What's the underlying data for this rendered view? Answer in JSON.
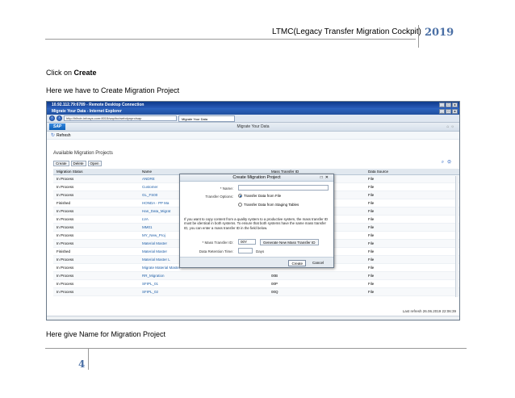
{
  "header": {
    "title": "LTMC(Legacy Transfer Migration Cockpit)",
    "year": "2019"
  },
  "body": {
    "line1_prefix": "Click on ",
    "line1_bold": "Create",
    "line2": "Here we have to Create Migration Project",
    "line3": "Here give Name for Migration Project"
  },
  "footer": {
    "page_number": "4"
  },
  "screenshot": {
    "rdp_title": "10.92.112.79:6789 - Remote Desktop Connection",
    "ie_title": "Migrate Your Data - Internet Explorer",
    "address": "http://hlhctr-infosys.com:8015/sap/bc/webdynpro/sap",
    "tab_label": "Migrate Your Data",
    "sap_logo": "SAP",
    "app_title": "Migrate Your Data",
    "refresh_label": "Refresh",
    "section_title": "Available Migration Projects",
    "buttons": {
      "create": "Create",
      "delete": "Delete",
      "open": "Open"
    },
    "columns": [
      "Migration Status",
      "Name",
      "Mass Transfer ID",
      "Data Source"
    ],
    "rows": [
      {
        "status": "In Process",
        "name": "ANDRE",
        "id": "",
        "source": "File"
      },
      {
        "status": "In Process",
        "name": "Customer",
        "id": "",
        "source": "File"
      },
      {
        "status": "In Process",
        "name": "GL_FS00",
        "id": "",
        "source": "File"
      },
      {
        "status": "Finished",
        "name": "HONDA - PP Ma",
        "id": "",
        "source": "File"
      },
      {
        "status": "In Process",
        "name": "Han_Data_Migrat",
        "id": "",
        "source": "File"
      },
      {
        "status": "In Process",
        "name": "LVA",
        "id": "",
        "source": "File"
      },
      {
        "status": "In Process",
        "name": "MM01",
        "id": "",
        "source": "File"
      },
      {
        "status": "In Process",
        "name": "MY_New_Proj",
        "id": "",
        "source": "File"
      },
      {
        "status": "In Process",
        "name": "Material Master",
        "id": "",
        "source": "File"
      },
      {
        "status": "Finished",
        "name": "Material Master",
        "id": "",
        "source": "File"
      },
      {
        "status": "In Process",
        "name": "Material Master L",
        "id": "",
        "source": "File"
      },
      {
        "status": "In Process",
        "name": "Migrate Material Master",
        "id": "",
        "source": "File"
      },
      {
        "status": "In Process",
        "name": "RR_Migration",
        "id": "00B",
        "source": "File"
      },
      {
        "status": "In Process",
        "name": "SFIPL_01",
        "id": "00P",
        "source": "File"
      },
      {
        "status": "In Process",
        "name": "SFIPL_02",
        "id": "00Q",
        "source": "File"
      }
    ],
    "last_refresh": "Last refresh 26.06.2019 22:06:39",
    "dialog": {
      "title": "Create Migration Project",
      "name_label": "* Name:",
      "name_value": "",
      "transfer_label": "Transfer Options:",
      "option1": "Transfer Data from File",
      "option2": "Transfer Data from Staging Tables",
      "info": "If you want to copy content from a quality system to a productive system, the mass transfer ID must be identical in both systems. To ensure that both systems have the same mass transfer ID, you can enter a mass transfer ID in the field below.",
      "mass_label": "* Mass Transfer ID:",
      "mass_value": "00Y",
      "generate_label": "Generate New Mass Transfer ID",
      "retention_label": "Data Retention Time:",
      "retention_value": "",
      "days_label": "Days",
      "create_label": "Create",
      "cancel_label": "Cancel"
    }
  }
}
